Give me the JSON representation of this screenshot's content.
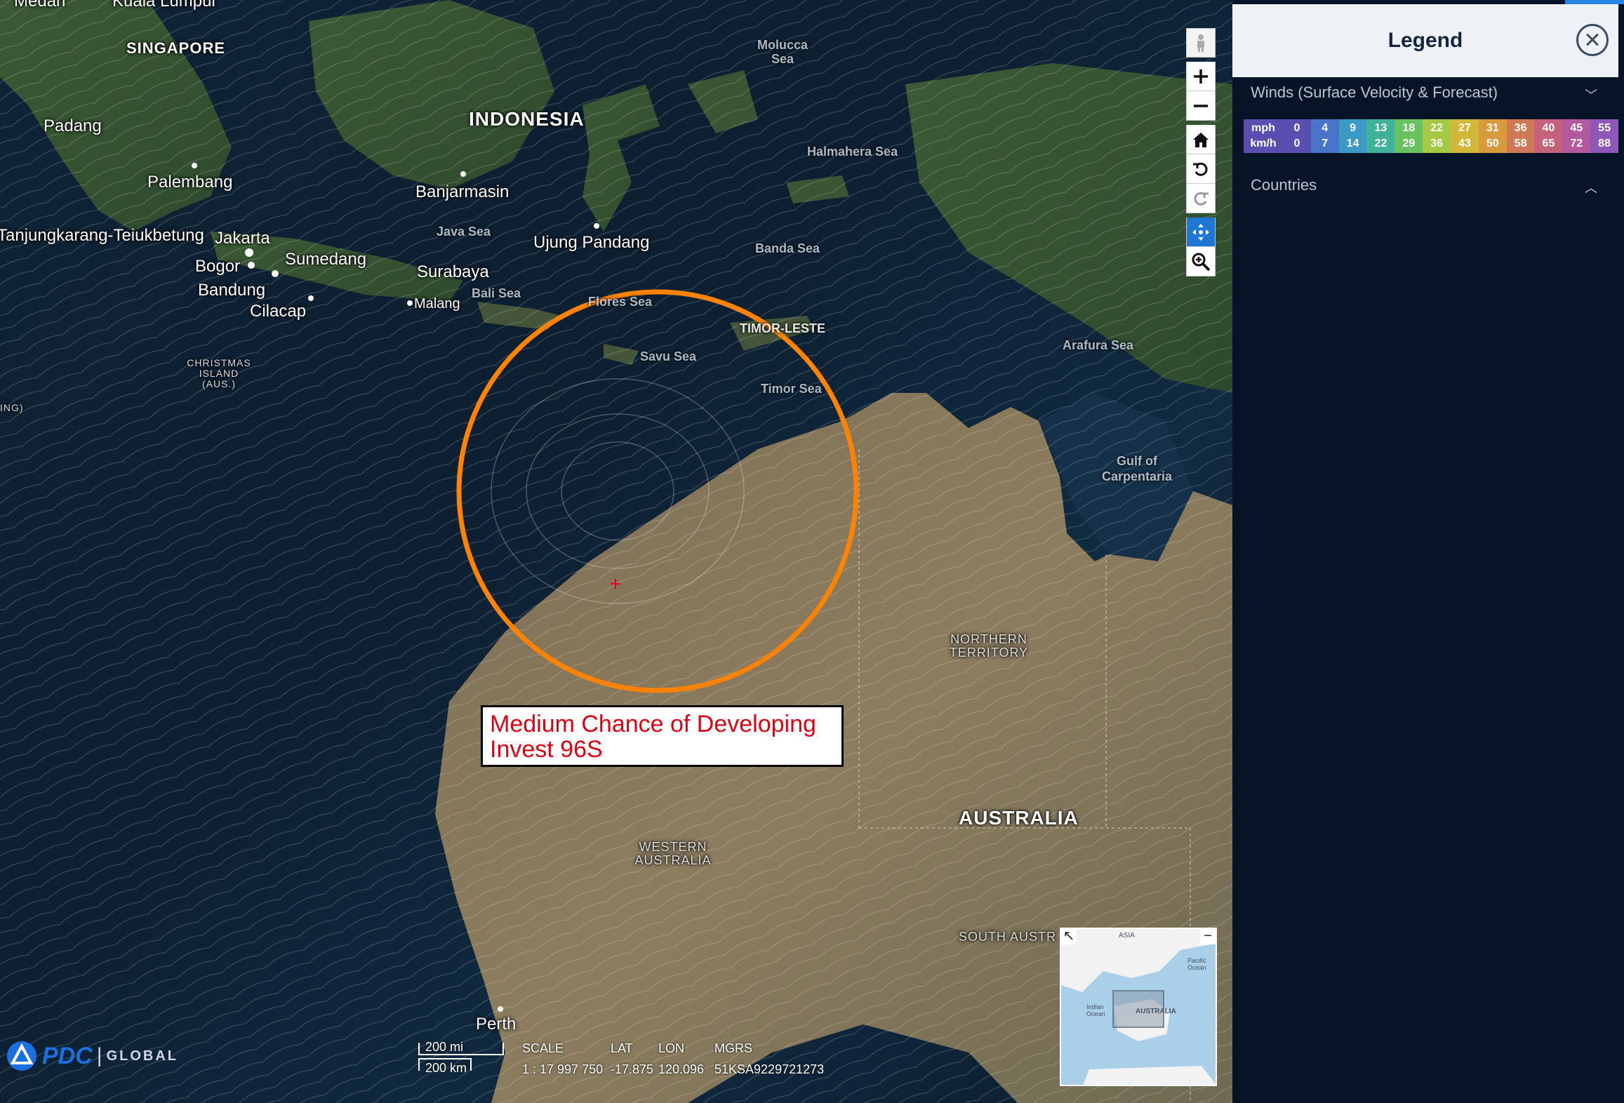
{
  "map": {
    "labels": {
      "countries": {
        "indonesia": "INDONESIA",
        "australia": "AUSTRALIA",
        "singapore": "SINGAPORE",
        "timor_leste": "TIMOR-LESTE"
      },
      "cities": {
        "medan": "Medan",
        "kuala_lumpur": "Kuala Lumpur",
        "padang": "Padang",
        "palembang": "Palembang",
        "tanjungkarang": "Tanjungkarang-Teiukbetung",
        "jakarta": "Jakarta",
        "bogor": "Bogor",
        "bandung": "Bandung",
        "sumedang": "Sumedang",
        "cilacap": "Cilacap",
        "surabaya": "Surabaya",
        "malang": "Malang",
        "banjarmasin": "Banjarmasin",
        "ujung_pandang": "Ujung Pandang",
        "perth": "Perth"
      },
      "seas": {
        "molucca": "Molucca Sea",
        "halmahera": "Halmahera Sea",
        "banda": "Banda Sea",
        "java": "Java Sea",
        "bali": "Bali Sea",
        "flores": "Flores Sea",
        "savu": "Savu Sea",
        "timor": "Timor Sea",
        "arafura": "Arafura Sea",
        "carpentaria": "Gulf of Carpentaria"
      },
      "regions": {
        "christmas": "CHRISTMAS ISLAND (AUS.)",
        "northern_territory": "NORTHERN TERRITORY",
        "western_australia": "WESTERN AUSTRALIA",
        "south_australia": "SOUTH AUSTR",
        "partial_left": "ING)"
      }
    },
    "annotation": {
      "line1": "Medium Chance of Developing",
      "line2": "Invest 96S",
      "circle_color": "#ff8200",
      "text_color": "#e00012"
    },
    "tools": {
      "street_view": "person-icon",
      "zoom_in": "plus-icon",
      "zoom_out": "minus-icon",
      "home": "home-icon",
      "rotate_left": "rotate-left-icon",
      "rotate_right": "rotate-right-icon",
      "pan": "pan-arrows-icon",
      "zoom_box": "zoom-box-icon"
    },
    "scale": {
      "miles": "200 mi",
      "km": "200 km"
    },
    "coordinates": {
      "scale_label": "SCALE",
      "scale_value": "1 : 17 997 750",
      "lat_label": "LAT",
      "lat_value": "-17.875",
      "lon_label": "LON",
      "lon_value": "120.096",
      "mgrs_label": "MGRS",
      "mgrs_value": "51KSA9229721273"
    },
    "logo": {
      "brand": "PDC",
      "separator": "|",
      "suffix": "GLOBAL"
    },
    "minimap": {
      "asia": "ASIA",
      "pacific": "Pacific Ocean",
      "indian": "Indian Ocean",
      "australia": "AUSTRALIA",
      "collapse": "−",
      "expand": "↖"
    }
  },
  "legend": {
    "title": "Legend",
    "close_icon": "close-circle-icon",
    "sections": [
      {
        "title": "Winds (Surface Velocity & Forecast)",
        "state": "expanded"
      },
      {
        "title": "Countries",
        "state": "collapsed"
      }
    ],
    "wind_scale": {
      "mph_label": "mph",
      "kmh_label": "km/h",
      "mph": [
        "0",
        "4",
        "9",
        "13",
        "18",
        "22",
        "27",
        "31",
        "36",
        "40",
        "45",
        "55"
      ],
      "kmh": [
        "0",
        "7",
        "14",
        "22",
        "29",
        "36",
        "43",
        "50",
        "58",
        "65",
        "72",
        "88"
      ],
      "colors": [
        "#5a4fb0",
        "#4a74c9",
        "#3c9bc4",
        "#3fb39a",
        "#69c25f",
        "#a6c943",
        "#d2b83a",
        "#d89a3c",
        "#cf7a55",
        "#c5627a",
        "#b35a9f",
        "#8e58b8"
      ]
    }
  }
}
